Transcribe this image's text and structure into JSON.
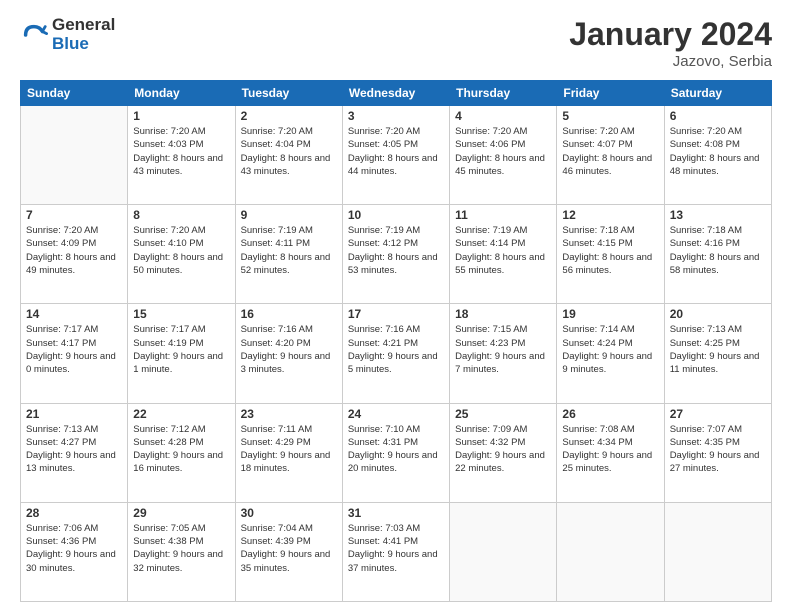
{
  "logo": {
    "general": "General",
    "blue": "Blue"
  },
  "header": {
    "month_year": "January 2024",
    "location": "Jazovo, Serbia"
  },
  "weekdays": [
    "Sunday",
    "Monday",
    "Tuesday",
    "Wednesday",
    "Thursday",
    "Friday",
    "Saturday"
  ],
  "weeks": [
    [
      {
        "day": "",
        "sunrise": "",
        "sunset": "",
        "daylight": "",
        "empty": true
      },
      {
        "day": "1",
        "sunrise": "7:20 AM",
        "sunset": "4:03 PM",
        "daylight": "8 hours and 43 minutes."
      },
      {
        "day": "2",
        "sunrise": "7:20 AM",
        "sunset": "4:04 PM",
        "daylight": "8 hours and 43 minutes."
      },
      {
        "day": "3",
        "sunrise": "7:20 AM",
        "sunset": "4:05 PM",
        "daylight": "8 hours and 44 minutes."
      },
      {
        "day": "4",
        "sunrise": "7:20 AM",
        "sunset": "4:06 PM",
        "daylight": "8 hours and 45 minutes."
      },
      {
        "day": "5",
        "sunrise": "7:20 AM",
        "sunset": "4:07 PM",
        "daylight": "8 hours and 46 minutes."
      },
      {
        "day": "6",
        "sunrise": "7:20 AM",
        "sunset": "4:08 PM",
        "daylight": "8 hours and 48 minutes."
      }
    ],
    [
      {
        "day": "7",
        "sunrise": "7:20 AM",
        "sunset": "4:09 PM",
        "daylight": "8 hours and 49 minutes."
      },
      {
        "day": "8",
        "sunrise": "7:20 AM",
        "sunset": "4:10 PM",
        "daylight": "8 hours and 50 minutes."
      },
      {
        "day": "9",
        "sunrise": "7:19 AM",
        "sunset": "4:11 PM",
        "daylight": "8 hours and 52 minutes."
      },
      {
        "day": "10",
        "sunrise": "7:19 AM",
        "sunset": "4:12 PM",
        "daylight": "8 hours and 53 minutes."
      },
      {
        "day": "11",
        "sunrise": "7:19 AM",
        "sunset": "4:14 PM",
        "daylight": "8 hours and 55 minutes."
      },
      {
        "day": "12",
        "sunrise": "7:18 AM",
        "sunset": "4:15 PM",
        "daylight": "8 hours and 56 minutes."
      },
      {
        "day": "13",
        "sunrise": "7:18 AM",
        "sunset": "4:16 PM",
        "daylight": "8 hours and 58 minutes."
      }
    ],
    [
      {
        "day": "14",
        "sunrise": "7:17 AM",
        "sunset": "4:17 PM",
        "daylight": "9 hours and 0 minutes."
      },
      {
        "day": "15",
        "sunrise": "7:17 AM",
        "sunset": "4:19 PM",
        "daylight": "9 hours and 1 minute."
      },
      {
        "day": "16",
        "sunrise": "7:16 AM",
        "sunset": "4:20 PM",
        "daylight": "9 hours and 3 minutes."
      },
      {
        "day": "17",
        "sunrise": "7:16 AM",
        "sunset": "4:21 PM",
        "daylight": "9 hours and 5 minutes."
      },
      {
        "day": "18",
        "sunrise": "7:15 AM",
        "sunset": "4:23 PM",
        "daylight": "9 hours and 7 minutes."
      },
      {
        "day": "19",
        "sunrise": "7:14 AM",
        "sunset": "4:24 PM",
        "daylight": "9 hours and 9 minutes."
      },
      {
        "day": "20",
        "sunrise": "7:13 AM",
        "sunset": "4:25 PM",
        "daylight": "9 hours and 11 minutes."
      }
    ],
    [
      {
        "day": "21",
        "sunrise": "7:13 AM",
        "sunset": "4:27 PM",
        "daylight": "9 hours and 13 minutes."
      },
      {
        "day": "22",
        "sunrise": "7:12 AM",
        "sunset": "4:28 PM",
        "daylight": "9 hours and 16 minutes."
      },
      {
        "day": "23",
        "sunrise": "7:11 AM",
        "sunset": "4:29 PM",
        "daylight": "9 hours and 18 minutes."
      },
      {
        "day": "24",
        "sunrise": "7:10 AM",
        "sunset": "4:31 PM",
        "daylight": "9 hours and 20 minutes."
      },
      {
        "day": "25",
        "sunrise": "7:09 AM",
        "sunset": "4:32 PM",
        "daylight": "9 hours and 22 minutes."
      },
      {
        "day": "26",
        "sunrise": "7:08 AM",
        "sunset": "4:34 PM",
        "daylight": "9 hours and 25 minutes."
      },
      {
        "day": "27",
        "sunrise": "7:07 AM",
        "sunset": "4:35 PM",
        "daylight": "9 hours and 27 minutes."
      }
    ],
    [
      {
        "day": "28",
        "sunrise": "7:06 AM",
        "sunset": "4:36 PM",
        "daylight": "9 hours and 30 minutes."
      },
      {
        "day": "29",
        "sunrise": "7:05 AM",
        "sunset": "4:38 PM",
        "daylight": "9 hours and 32 minutes."
      },
      {
        "day": "30",
        "sunrise": "7:04 AM",
        "sunset": "4:39 PM",
        "daylight": "9 hours and 35 minutes."
      },
      {
        "day": "31",
        "sunrise": "7:03 AM",
        "sunset": "4:41 PM",
        "daylight": "9 hours and 37 minutes."
      },
      {
        "day": "",
        "sunrise": "",
        "sunset": "",
        "daylight": "",
        "empty": true
      },
      {
        "day": "",
        "sunrise": "",
        "sunset": "",
        "daylight": "",
        "empty": true
      },
      {
        "day": "",
        "sunrise": "",
        "sunset": "",
        "daylight": "",
        "empty": true
      }
    ]
  ]
}
